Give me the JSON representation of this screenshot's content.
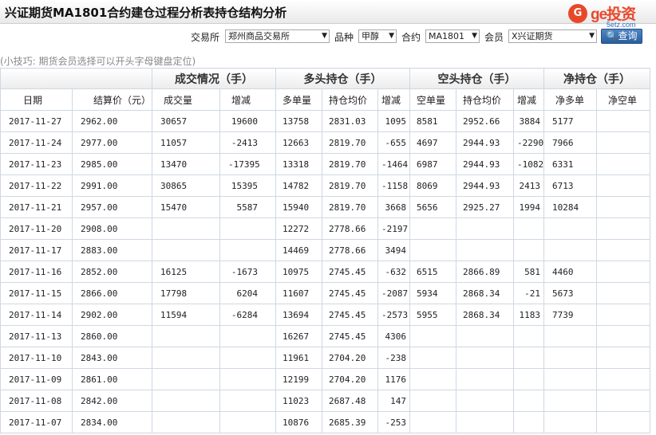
{
  "header": {
    "title": "兴证期货MA1801合约建仓过程分析表持仓结构分析",
    "logo": {
      "mark": "G",
      "brand": "ge投资",
      "site": "5etz.com"
    }
  },
  "filters": {
    "exchange_label": "交易所",
    "exchange_value": "郑州商品交易所",
    "variety_label": "品种",
    "variety_value": "甲醇",
    "contract_label": "合约",
    "contract_value": "MA1801",
    "member_label": "会员",
    "member_value": "X兴证期货",
    "query_label": "查询"
  },
  "tip": "(小技巧: 期货会员选择可以开头字母键盘定位)",
  "table": {
    "groups": {
      "trade": "成交情况（手）",
      "long": "多头持仓（手）",
      "short": "空头持仓（手）",
      "net": "净持仓（手）"
    },
    "columns": {
      "date": "日期",
      "settle": "结算价（元）",
      "volume": "成交量",
      "volume_chg": "增减",
      "long_qty": "多单量",
      "long_avg": "持仓均价",
      "long_chg": "增减",
      "short_qty": "空单量",
      "short_avg": "持仓均价",
      "short_chg": "增减",
      "net_long": "净多单",
      "net_short": "净空单"
    },
    "rows": [
      {
        "date": "2017-11-27",
        "settle": "2962.00",
        "volume": "30657",
        "volume_chg": "19600",
        "long_qty": "13758",
        "long_avg": "2831.03",
        "long_chg": "1095",
        "short_qty": "8581",
        "short_avg": "2952.66",
        "short_chg": "3884",
        "net_long": "5177",
        "net_short": ""
      },
      {
        "date": "2017-11-24",
        "settle": "2977.00",
        "volume": "11057",
        "volume_chg": "-2413",
        "long_qty": "12663",
        "long_avg": "2819.70",
        "long_chg": "-655",
        "short_qty": "4697",
        "short_avg": "2944.93",
        "short_chg": "-2290",
        "net_long": "7966",
        "net_short": ""
      },
      {
        "date": "2017-11-23",
        "settle": "2985.00",
        "volume": "13470",
        "volume_chg": "-17395",
        "long_qty": "13318",
        "long_avg": "2819.70",
        "long_chg": "-1464",
        "short_qty": "6987",
        "short_avg": "2944.93",
        "short_chg": "-1082",
        "net_long": "6331",
        "net_short": ""
      },
      {
        "date": "2017-11-22",
        "settle": "2991.00",
        "volume": "30865",
        "volume_chg": "15395",
        "long_qty": "14782",
        "long_avg": "2819.70",
        "long_chg": "-1158",
        "short_qty": "8069",
        "short_avg": "2944.93",
        "short_chg": "2413",
        "net_long": "6713",
        "net_short": ""
      },
      {
        "date": "2017-11-21",
        "settle": "2957.00",
        "volume": "15470",
        "volume_chg": "5587",
        "long_qty": "15940",
        "long_avg": "2819.70",
        "long_chg": "3668",
        "short_qty": "5656",
        "short_avg": "2925.27",
        "short_chg": "1994",
        "net_long": "10284",
        "net_short": ""
      },
      {
        "date": "2017-11-20",
        "settle": "2908.00",
        "volume": "",
        "volume_chg": "",
        "long_qty": "12272",
        "long_avg": "2778.66",
        "long_chg": "-2197",
        "short_qty": "",
        "short_avg": "",
        "short_chg": "",
        "net_long": "",
        "net_short": ""
      },
      {
        "date": "2017-11-17",
        "settle": "2883.00",
        "volume": "",
        "volume_chg": "",
        "long_qty": "14469",
        "long_avg": "2778.66",
        "long_chg": "3494",
        "short_qty": "",
        "short_avg": "",
        "short_chg": "",
        "net_long": "",
        "net_short": ""
      },
      {
        "date": "2017-11-16",
        "settle": "2852.00",
        "volume": "16125",
        "volume_chg": "-1673",
        "long_qty": "10975",
        "long_avg": "2745.45",
        "long_chg": "-632",
        "short_qty": "6515",
        "short_avg": "2866.89",
        "short_chg": "581",
        "net_long": "4460",
        "net_short": ""
      },
      {
        "date": "2017-11-15",
        "settle": "2866.00",
        "volume": "17798",
        "volume_chg": "6204",
        "long_qty": "11607",
        "long_avg": "2745.45",
        "long_chg": "-2087",
        "short_qty": "5934",
        "short_avg": "2868.34",
        "short_chg": "-21",
        "net_long": "5673",
        "net_short": ""
      },
      {
        "date": "2017-11-14",
        "settle": "2902.00",
        "volume": "11594",
        "volume_chg": "-6284",
        "long_qty": "13694",
        "long_avg": "2745.45",
        "long_chg": "-2573",
        "short_qty": "5955",
        "short_avg": "2868.34",
        "short_chg": "1183",
        "net_long": "7739",
        "net_short": ""
      },
      {
        "date": "2017-11-13",
        "settle": "2860.00",
        "volume": "",
        "volume_chg": "",
        "long_qty": "16267",
        "long_avg": "2745.45",
        "long_chg": "4306",
        "short_qty": "",
        "short_avg": "",
        "short_chg": "",
        "net_long": "",
        "net_short": ""
      },
      {
        "date": "2017-11-10",
        "settle": "2843.00",
        "volume": "",
        "volume_chg": "",
        "long_qty": "11961",
        "long_avg": "2704.20",
        "long_chg": "-238",
        "short_qty": "",
        "short_avg": "",
        "short_chg": "",
        "net_long": "",
        "net_short": ""
      },
      {
        "date": "2017-11-09",
        "settle": "2861.00",
        "volume": "",
        "volume_chg": "",
        "long_qty": "12199",
        "long_avg": "2704.20",
        "long_chg": "1176",
        "short_qty": "",
        "short_avg": "",
        "short_chg": "",
        "net_long": "",
        "net_short": ""
      },
      {
        "date": "2017-11-08",
        "settle": "2842.00",
        "volume": "",
        "volume_chg": "",
        "long_qty": "11023",
        "long_avg": "2687.48",
        "long_chg": "147",
        "short_qty": "",
        "short_avg": "",
        "short_chg": "",
        "net_long": "",
        "net_short": ""
      },
      {
        "date": "2017-11-07",
        "settle": "2834.00",
        "volume": "",
        "volume_chg": "",
        "long_qty": "10876",
        "long_avg": "2685.39",
        "long_chg": "-253",
        "short_qty": "",
        "short_avg": "",
        "short_chg": "",
        "net_long": "",
        "net_short": ""
      }
    ]
  },
  "colors": {
    "increase": "#e00000",
    "decrease": "#009900",
    "accent": "#2a5f9e",
    "logo": "#e8482a"
  }
}
